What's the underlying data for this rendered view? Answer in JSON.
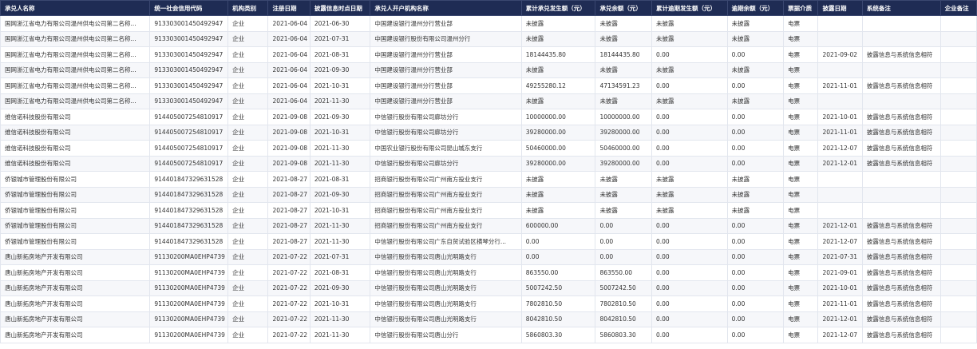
{
  "columns": [
    "承兑人名称",
    "统一社会信用代码",
    "机构类别",
    "注册日期",
    "披露信息时点日期",
    "承兑人开户机构名称",
    "累计承兑发生额（元）",
    "承兑余额（元）",
    "累计逾期发生额（元）",
    "逾期余额（元）",
    "票据介质",
    "披露日期",
    "系统备注",
    "企业备注"
  ],
  "rows": [
    [
      "国网浙江省电力有限公司温州供电公司第二名称...",
      "913303001450492947",
      "企业",
      "2021-06-04",
      "2021-06-30",
      "中国建设银行温州分行营业部",
      "未披露",
      "未披露",
      "未披露",
      "未披露",
      "电票",
      "",
      "",
      ""
    ],
    [
      "国网浙江省电力有限公司温州供电公司第二名称...",
      "913303001450492947",
      "企业",
      "2021-06-04",
      "2021-07-31",
      "中国建设银行股份有限公司温州分行",
      "未披露",
      "未披露",
      "未披露",
      "未披露",
      "电票",
      "",
      "",
      ""
    ],
    [
      "国网浙江省电力有限公司温州供电公司第二名称...",
      "913303001450492947",
      "企业",
      "2021-06-04",
      "2021-08-31",
      "中国建设银行温州分行营业部",
      "18144435.80",
      "18144435.80",
      "0.00",
      "0.00",
      "电票",
      "2021-09-02",
      "披露信息与系统信息相符",
      ""
    ],
    [
      "国网浙江省电力有限公司温州供电公司第二名称...",
      "913303001450492947",
      "企业",
      "2021-06-04",
      "2021-09-30",
      "中国建设银行温州分行营业部",
      "未披露",
      "未披露",
      "未披露",
      "未披露",
      "电票",
      "",
      "",
      ""
    ],
    [
      "国网浙江省电力有限公司温州供电公司第二名称...",
      "913303001450492947",
      "企业",
      "2021-06-04",
      "2021-10-31",
      "中国建设银行温州分行营业部",
      "49255280.12",
      "47134591.23",
      "0.00",
      "0.00",
      "电票",
      "2021-11-01",
      "披露信息与系统信息相符",
      ""
    ],
    [
      "国网浙江省电力有限公司温州供电公司第二名称...",
      "913303001450492947",
      "企业",
      "2021-06-04",
      "2021-11-30",
      "中国建设银行温州分行营业部",
      "未披露",
      "未披露",
      "未披露",
      "未披露",
      "电票",
      "",
      "",
      ""
    ],
    [
      "维信诺科技股份有限公司",
      "914405007254810917",
      "企业",
      "2021-09-08",
      "2021-09-30",
      "中信银行股份有限公司廊坊分行",
      "10000000.00",
      "10000000.00",
      "0.00",
      "0.00",
      "电票",
      "2021-10-01",
      "披露信息与系统信息相符",
      ""
    ],
    [
      "维信诺科技股份有限公司",
      "914405007254810917",
      "企业",
      "2021-09-08",
      "2021-10-31",
      "中信银行股份有限公司廊坊分行",
      "39280000.00",
      "39280000.00",
      "0.00",
      "0.00",
      "电票",
      "2021-11-01",
      "披露信息与系统信息相符",
      ""
    ],
    [
      "维信诺科技股份有限公司",
      "914405007254810917",
      "企业",
      "2021-09-08",
      "2021-11-30",
      "中国农业银行股份有限公司昆山城东支行",
      "50460000.00",
      "50460000.00",
      "0.00",
      "0.00",
      "电票",
      "2021-12-07",
      "披露信息与系统信息相符",
      ""
    ],
    [
      "维信诺科技股份有限公司",
      "914405007254810917",
      "企业",
      "2021-09-08",
      "2021-11-30",
      "中信银行股份有限公司廊坊分行",
      "39280000.00",
      "39280000.00",
      "0.00",
      "0.00",
      "电票",
      "2021-12-01",
      "披露信息与系统信息相符",
      ""
    ],
    [
      "侨银城市管理股份有限公司",
      "914401847329631528",
      "企业",
      "2021-08-27",
      "2021-08-31",
      "招商银行股份有限公司广州南方投业支行",
      "未披露",
      "未披露",
      "未披露",
      "未披露",
      "电票",
      "",
      "",
      ""
    ],
    [
      "侨银城市管理股份有限公司",
      "914401847329631528",
      "企业",
      "2021-08-27",
      "2021-09-30",
      "招商银行股份有限公司广州南方投业支行",
      "未披露",
      "未披露",
      "未披露",
      "未披露",
      "电票",
      "",
      "",
      ""
    ],
    [
      "侨银城市管理股份有限公司",
      "914401847329631528",
      "企业",
      "2021-08-27",
      "2021-10-31",
      "招商银行股份有限公司广州南方投业支行",
      "未披露",
      "未披露",
      "未披露",
      "未披露",
      "电票",
      "",
      "",
      ""
    ],
    [
      "侨银城市管理股份有限公司",
      "914401847329631528",
      "企业",
      "2021-08-27",
      "2021-11-30",
      "招商银行股份有限公司广州南方投业支行",
      "600000.00",
      "0.00",
      "0.00",
      "0.00",
      "电票",
      "2021-12-01",
      "披露信息与系统信息相符",
      ""
    ],
    [
      "侨银城市管理股份有限公司",
      "914401847329631528",
      "企业",
      "2021-08-27",
      "2021-11-30",
      "中信银行股份有限公司广东自贸试验区横琴分行...",
      "0.00",
      "0.00",
      "0.00",
      "0.00",
      "电票",
      "2021-12-07",
      "披露信息与系统信息相符",
      ""
    ],
    [
      "唐山新拓房地产开发有限公司",
      "91130200MA0EHP4739",
      "企业",
      "2021-07-22",
      "2021-07-31",
      "中信银行股份有限公司唐山光明路支行",
      "0.00",
      "0.00",
      "0.00",
      "0.00",
      "电票",
      "2021-07-31",
      "披露信息与系统信息相符",
      ""
    ],
    [
      "唐山新拓房地产开发有限公司",
      "91130200MA0EHP4739",
      "企业",
      "2021-07-22",
      "2021-08-31",
      "中信银行股份有限公司唐山光明路支行",
      "863550.00",
      "863550.00",
      "0.00",
      "0.00",
      "电票",
      "2021-09-01",
      "披露信息与系统信息相符",
      ""
    ],
    [
      "唐山新拓房地产开发有限公司",
      "91130200MA0EHP4739",
      "企业",
      "2021-07-22",
      "2021-09-30",
      "中信银行股份有限公司唐山光明路支行",
      "5007242.50",
      "5007242.50",
      "0.00",
      "0.00",
      "电票",
      "2021-10-01",
      "披露信息与系统信息相符",
      ""
    ],
    [
      "唐山新拓房地产开发有限公司",
      "91130200MA0EHP4739",
      "企业",
      "2021-07-22",
      "2021-10-31",
      "中信银行股份有限公司唐山光明路支行",
      "7802810.50",
      "7802810.50",
      "0.00",
      "0.00",
      "电票",
      "2021-11-01",
      "披露信息与系统信息相符",
      ""
    ],
    [
      "唐山新拓房地产开发有限公司",
      "91130200MA0EHP4739",
      "企业",
      "2021-07-22",
      "2021-11-30",
      "中信银行股份有限公司唐山光明路支行",
      "8042810.50",
      "8042810.50",
      "0.00",
      "0.00",
      "电票",
      "2021-12-01",
      "披露信息与系统信息相符",
      ""
    ],
    [
      "唐山新拓房地产开发有限公司",
      "91130200MA0EHP4739",
      "企业",
      "2021-07-22",
      "2021-11-30",
      "中信银行股份有限公司唐山分行",
      "5860803.30",
      "5860803.30",
      "0.00",
      "0.00",
      "电票",
      "2021-12-07",
      "披露信息与系统信息相符",
      ""
    ]
  ]
}
